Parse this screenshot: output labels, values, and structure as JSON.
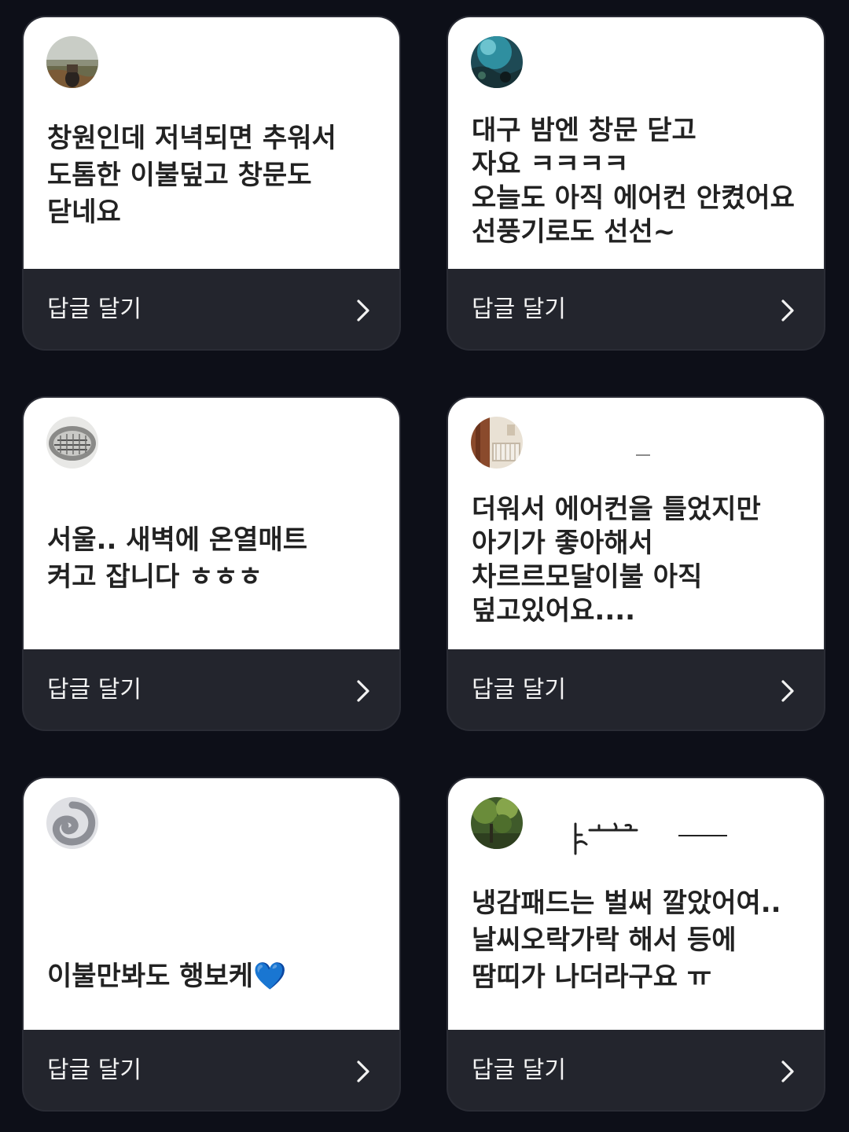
{
  "cards": [
    {
      "avatar": "field-photo-avatar",
      "text": "창원인데 저녁되면 추워서\n도톰한 이불덮고 창문도\n닫네요",
      "reply_label": "답글 달기"
    },
    {
      "avatar": "aquarium-photo-avatar",
      "text": "대구 밤엔 창문 닫고\n자요 ㅋㅋㅋㅋ\n오늘도 아직 에어컨 안켰어요\n선풍기로도 선선~",
      "reply_label": "답글 달기"
    },
    {
      "avatar": "building-photo-avatar",
      "text": "서울.. 새벽에 온열매트\n켜고 잡니다 ㅎㅎㅎ",
      "reply_label": "답글 달기"
    },
    {
      "avatar": "room-photo-avatar",
      "text": "더워서 에어컨을 틀었지만\n아기가 좋아해서\n차르르모달이불 아직\n덮고있어요....",
      "reply_label": "답글 달기"
    },
    {
      "avatar": "swirl-avatar",
      "text": "이불만봐도 행보케",
      "emoji": "💙",
      "reply_label": "답글 달기"
    },
    {
      "avatar": "forest-photo-avatar",
      "text": "냉감패드는 벌써 깔았어여..\n날씨오락가락 해서 등에\n땀띠가 나더라구요 ㅠ",
      "reply_label": "답글 달기"
    }
  ],
  "icons": {
    "chevron": "chevron-right-icon",
    "heart": "blue-heart-emoji"
  }
}
